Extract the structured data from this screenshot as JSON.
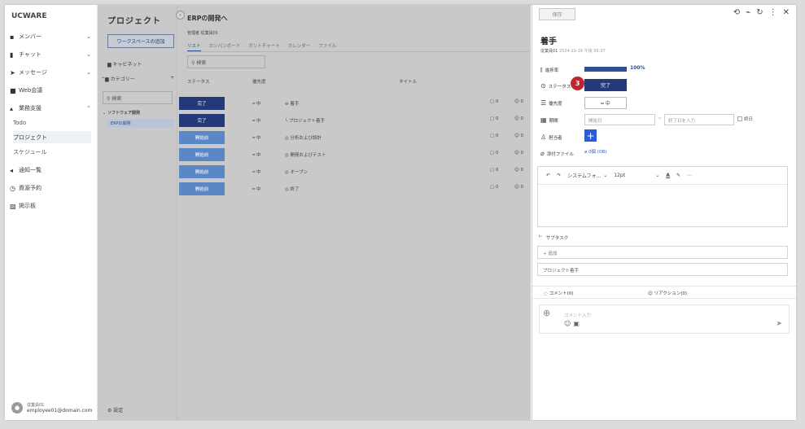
{
  "app": {
    "name": "UCWARE"
  },
  "nav": {
    "items": [
      {
        "label": "メンバー",
        "icon": "members-icon",
        "chev": "⌄"
      },
      {
        "label": "チャット",
        "icon": "chat-icon",
        "chev": "⌄"
      },
      {
        "label": "メッセージ",
        "icon": "message-icon",
        "chev": "⌄"
      },
      {
        "label": "Web会議",
        "icon": "video-icon",
        "chev": ""
      },
      {
        "label": "業務支援",
        "icon": "work-icon",
        "chev": "⌃"
      }
    ],
    "sub": [
      "Todo",
      "プロジェクト",
      "スケジュール"
    ],
    "items2": [
      {
        "label": "通知一覧",
        "icon": "notice-icon"
      },
      {
        "label": "資源予約",
        "icon": "clock-icon"
      },
      {
        "label": "掲示板",
        "icon": "board-icon"
      }
    ],
    "user": {
      "name": "従業員01",
      "email": "employee01@domain.com"
    }
  },
  "project": {
    "title": "プロジェクト",
    "workspace_btn": "ワークスペースの追加",
    "cabinet": "キャビネット",
    "category": "カテゴリー",
    "search_ph": "検索",
    "tree_root": "ソフトウェア開発",
    "tree_child": "ERPの開発",
    "settings": "設定"
  },
  "main": {
    "title": "ERPの開発へ",
    "manager": "管理者  従業員01",
    "tabs": [
      "リスト",
      "カンバンボード",
      "ガントチャート",
      "カレンダー",
      "ファイル"
    ],
    "search_ph": "検索",
    "headers": {
      "status": "ステータス",
      "priority": "優先度",
      "title": "タイトル"
    },
    "rows": [
      {
        "status": "完了",
        "priority": "═ 中",
        "title": "⊖ 着手",
        "comments": "0",
        "reactions": "0",
        "done": true
      },
      {
        "status": "完了",
        "priority": "═ 中",
        "title": "└ プロジェクト着手",
        "comments": "0",
        "reactions": "0",
        "done": true
      },
      {
        "status": "開始前",
        "priority": "═ 中",
        "title": "◎ 分析および設計",
        "comments": "0",
        "reactions": "0",
        "done": false
      },
      {
        "status": "開始前",
        "priority": "═ 中",
        "title": "◎ 開発およびテスト",
        "comments": "0",
        "reactions": "0",
        "done": false
      },
      {
        "status": "開始前",
        "priority": "═ 中",
        "title": "◎ オープン",
        "comments": "0",
        "reactions": "0",
        "done": false
      },
      {
        "status": "開始前",
        "priority": "═ 中",
        "title": "◎ 終了",
        "comments": "0",
        "reactions": "0",
        "done": false
      }
    ]
  },
  "panel": {
    "save": "保存",
    "title": "着手",
    "meta_user": "従業員01",
    "meta_date": "2024-10-16 午後 05:37",
    "progress_label": "進捗率",
    "progress_value": "100%",
    "progress_fraction": 1.0,
    "status_label": "ステータス",
    "status_value": "完了",
    "badge": "3",
    "priority_label": "優先度",
    "priority_value": "═ 中",
    "period_label": "期間",
    "start_ph": "開始日",
    "end_ph": "終了日を入力",
    "allday": "終日",
    "assignee_label": "担当者",
    "attach_label": "添付ファイル",
    "attach_value": "0個 (0B)",
    "editor": {
      "font": "システムフォ...",
      "size": "12pt"
    },
    "subtask_label": "サブタスク",
    "subtask_add": "追加",
    "subtask_item": "プロジェクト着手",
    "comments": "コメント(0)",
    "reactions": "リアクション(0)",
    "comment_ph": "コメント入力"
  }
}
